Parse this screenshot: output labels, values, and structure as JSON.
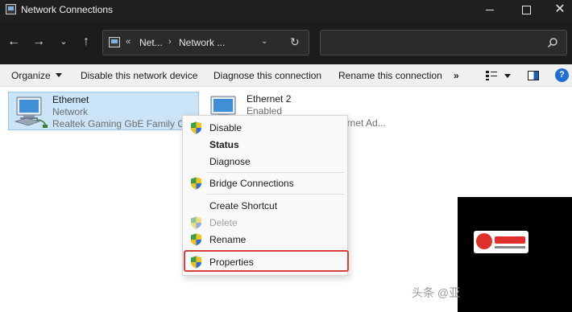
{
  "window": {
    "title": "Network Connections",
    "icon": "network-connections-icon"
  },
  "address_bar": {
    "overflow_glyph": "«",
    "crumbs": [
      "Net...",
      "Network ..."
    ],
    "separator": "›"
  },
  "search": {
    "placeholder": ""
  },
  "command_bar": {
    "organize": "Organize",
    "disable_device": "Disable this network device",
    "diagnose": "Diagnose this connection",
    "rename": "Rename this connection",
    "more": "»",
    "help": "?"
  },
  "adapters": [
    {
      "name": "Ethernet",
      "status": "Network",
      "device": "Realtek Gaming GbE Family Controller",
      "selected": true
    },
    {
      "name": "Ethernet 2",
      "status": "Enabled",
      "device": "ernet Ad..."
    }
  ],
  "context_menu": {
    "items": [
      {
        "label": "Disable",
        "shield": true
      },
      {
        "label": "Status",
        "bold": true
      },
      {
        "label": "Diagnose"
      },
      {
        "label": "Bridge Connections",
        "shield": true
      },
      {
        "label": "Create Shortcut"
      },
      {
        "label": "Delete",
        "shield": true,
        "disabled": true
      },
      {
        "label": "Rename",
        "shield": true
      },
      {
        "label": "Properties",
        "shield": true,
        "highlighted": true
      }
    ]
  },
  "colors": {
    "selection": "#cce4f7",
    "highlight_border": "#d9403a",
    "title_bar": "#1f1f1f"
  },
  "watermark": {
    "text": "头条 @亚"
  }
}
